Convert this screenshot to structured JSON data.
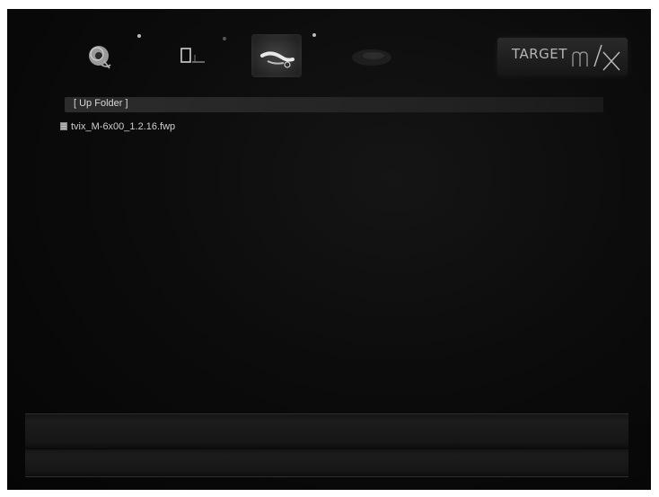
{
  "nav": {
    "items": [
      {
        "icon": "disc-music-icon",
        "label": "Music"
      },
      {
        "icon": "photo-frame-icon",
        "label": "Photo"
      },
      {
        "icon": "setup-tools-icon",
        "label": "Setup"
      },
      {
        "icon": "movie-icon",
        "label": "Movie"
      }
    ],
    "selected_index": 2
  },
  "brand": {
    "text": "TARGET",
    "mark": "mix-logo"
  },
  "browser": {
    "up_folder_label": "[ Up Folder ]",
    "files": [
      {
        "name": "tvix_M-6x00_1.2.16.fwp",
        "icon": "firmware-file-icon"
      }
    ]
  },
  "colors": {
    "background": "#0a0a0a",
    "text": "#d8d8d8",
    "highlight": "#2c2c2c"
  }
}
